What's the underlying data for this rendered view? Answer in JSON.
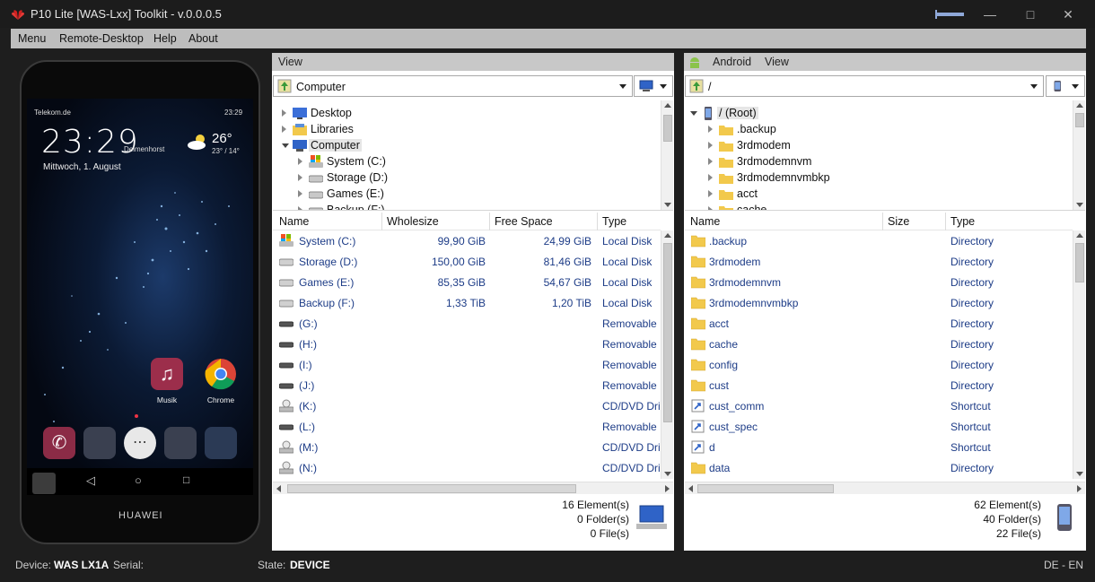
{
  "window": {
    "title": "P10 Lite [WAS-Lxx] Toolkit - v.0.0.0.5"
  },
  "menu": [
    "Menu",
    "Remote-Desktop",
    "Help",
    "About"
  ],
  "phone": {
    "carrier": "Telekom.de",
    "status_time": "23:29",
    "clock": "23:29",
    "city": "Delmenhorst",
    "temp": "26°",
    "temp_range": "23° / 14°",
    "date": "Mittwoch, 1. August",
    "apps": [
      "Musik",
      "Chrome"
    ],
    "brand": "HUAWEI"
  },
  "left": {
    "header": "View",
    "path": "Computer",
    "tree": [
      {
        "label": "Desktop",
        "icon": "desktop-icon"
      },
      {
        "label": "Libraries",
        "icon": "libraries-icon"
      },
      {
        "label": "Computer",
        "icon": "computer-icon"
      },
      {
        "label": "System (C:)",
        "icon": "system-drive-icon"
      },
      {
        "label": "Storage (D:)",
        "icon": "drive-icon"
      },
      {
        "label": "Games (E:)",
        "icon": "drive-icon"
      },
      {
        "label": "Backup (F:)",
        "icon": "drive-icon"
      }
    ],
    "columns": [
      "Name",
      "Wholesize",
      "Free Space",
      "Type"
    ],
    "rows": [
      {
        "name": "System (C:)",
        "size": "99,90 GiB",
        "free": "24,99 GiB",
        "type": "Local Disk",
        "icon": "system-drive-icon"
      },
      {
        "name": "Storage (D:)",
        "size": "150,00 GiB",
        "free": "81,46 GiB",
        "type": "Local Disk",
        "icon": "drive-icon"
      },
      {
        "name": "Games (E:)",
        "size": "85,35 GiB",
        "free": "54,67 GiB",
        "type": "Local Disk",
        "icon": "drive-icon"
      },
      {
        "name": "Backup (F:)",
        "size": "1,33 TiB",
        "free": "1,20 TiB",
        "type": "Local Disk",
        "icon": "drive-icon"
      },
      {
        "name": "(G:)",
        "size": "",
        "free": "",
        "type": "Removable",
        "icon": "removable-icon"
      },
      {
        "name": "(H:)",
        "size": "",
        "free": "",
        "type": "Removable",
        "icon": "removable-icon"
      },
      {
        "name": "(I:)",
        "size": "",
        "free": "",
        "type": "Removable",
        "icon": "removable-icon"
      },
      {
        "name": "(J:)",
        "size": "",
        "free": "",
        "type": "Removable",
        "icon": "removable-icon"
      },
      {
        "name": "(K:)",
        "size": "",
        "free": "",
        "type": "CD/DVD Dri",
        "icon": "cd-drive-icon"
      },
      {
        "name": "(L:)",
        "size": "",
        "free": "",
        "type": "Removable",
        "icon": "removable-icon"
      },
      {
        "name": "(M:)",
        "size": "",
        "free": "",
        "type": "CD/DVD Dri",
        "icon": "cd-drive-icon"
      },
      {
        "name": "(N:)",
        "size": "",
        "free": "",
        "type": "CD/DVD Dri",
        "icon": "cd-drive-icon"
      }
    ],
    "summary": [
      "16 Element(s)",
      "0 Folder(s)",
      "0 File(s)"
    ]
  },
  "right": {
    "header_left": "Android",
    "header_right": "View",
    "path": "/",
    "tree": [
      {
        "label": "/ (Root)",
        "icon": "phone-root-icon"
      },
      {
        "label": ".backup",
        "icon": "folder-icon"
      },
      {
        "label": "3rdmodem",
        "icon": "folder-icon"
      },
      {
        "label": "3rdmodemnvm",
        "icon": "folder-icon"
      },
      {
        "label": "3rdmodemnvmbkp",
        "icon": "folder-icon"
      },
      {
        "label": "acct",
        "icon": "folder-icon"
      },
      {
        "label": "cache",
        "icon": "folder-icon"
      }
    ],
    "columns": [
      "Name",
      "Size",
      "Type"
    ],
    "rows": [
      {
        "name": ".backup",
        "type": "Directory",
        "icon": "folder-icon"
      },
      {
        "name": "3rdmodem",
        "type": "Directory",
        "icon": "folder-icon"
      },
      {
        "name": "3rdmodemnvm",
        "type": "Directory",
        "icon": "folder-icon"
      },
      {
        "name": "3rdmodemnvmbkp",
        "type": "Directory",
        "icon": "folder-icon"
      },
      {
        "name": "acct",
        "type": "Directory",
        "icon": "folder-icon"
      },
      {
        "name": "cache",
        "type": "Directory",
        "icon": "folder-icon"
      },
      {
        "name": "config",
        "type": "Directory",
        "icon": "folder-icon"
      },
      {
        "name": "cust",
        "type": "Directory",
        "icon": "folder-icon"
      },
      {
        "name": "cust_comm",
        "type": "Shortcut",
        "icon": "shortcut-icon"
      },
      {
        "name": "cust_spec",
        "type": "Shortcut",
        "icon": "shortcut-icon"
      },
      {
        "name": "d",
        "type": "Shortcut",
        "icon": "shortcut-icon"
      },
      {
        "name": "data",
        "type": "Directory",
        "icon": "folder-icon"
      }
    ],
    "summary": [
      "62 Element(s)",
      "40 Folder(s)",
      "22 File(s)"
    ]
  },
  "status": {
    "device_label": "Device:",
    "device_value": "WAS LX1A",
    "serial_label": "Serial:",
    "state_label": "State:",
    "state_value": "DEVICE",
    "lang": "DE - EN"
  },
  "colors": {
    "accent_blue": "#1d3c87",
    "panel_header": "#c8c8c8",
    "folder": "#f2c94c"
  }
}
